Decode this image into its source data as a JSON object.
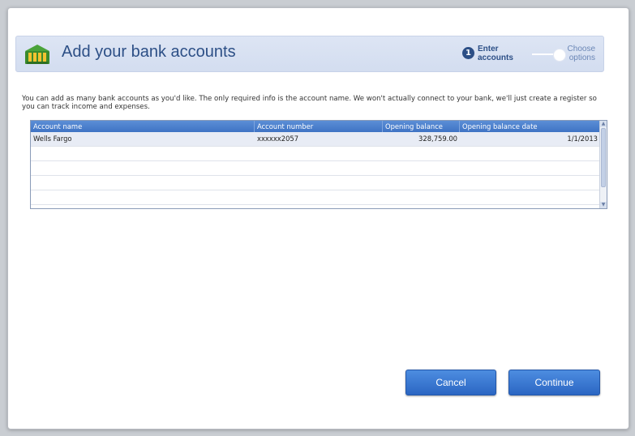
{
  "header": {
    "title": "Add your bank accounts",
    "icon": "bank-icon",
    "steps": [
      {
        "number": "1",
        "label": "Enter accounts",
        "active": true
      },
      {
        "label": "Choose options",
        "active": false
      }
    ]
  },
  "description": "You can add as many bank accounts as you'd like. The only required info is the account name. We won't actually connect to your bank, we'll just create a register so you can track income and expenses.",
  "table": {
    "columns": [
      "Account name",
      "Account number",
      "Opening balance",
      "Opening balance date"
    ],
    "rows": [
      [
        "Wells Fargo",
        "xxxxxx2057",
        "328,759.00",
        "1/1/2013"
      ],
      [
        "",
        "",
        "",
        ""
      ],
      [
        "",
        "",
        "",
        ""
      ],
      [
        "",
        "",
        "",
        ""
      ],
      [
        "",
        "",
        "",
        ""
      ]
    ]
  },
  "buttons": {
    "cancel": "Cancel",
    "continue": "Continue"
  },
  "colors": {
    "accent": "#3f73c4",
    "header_bg": "#d3ddf0",
    "title": "#2c4f86"
  }
}
